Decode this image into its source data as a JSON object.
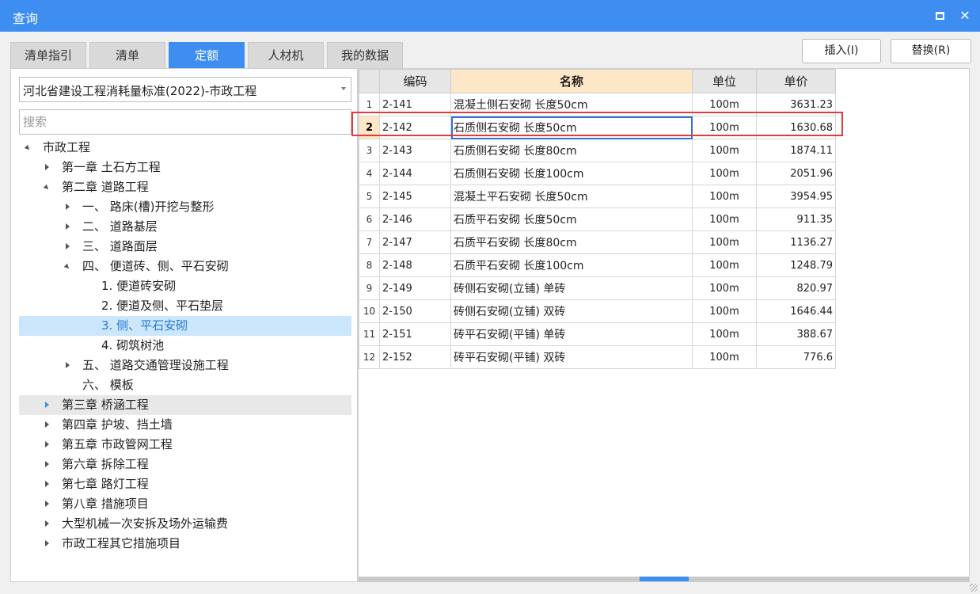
{
  "window": {
    "title": "查询"
  },
  "tabs": [
    {
      "label": "清单指引"
    },
    {
      "label": "清单"
    },
    {
      "label": "定额",
      "active": true
    },
    {
      "label": "人材机"
    },
    {
      "label": "我的数据"
    }
  ],
  "actions": {
    "insert": "插入(I)",
    "replace": "替换(R)"
  },
  "left": {
    "dropdown_value": "河北省建设工程消耗量标准(2022)-市政工程",
    "search_placeholder": "搜索"
  },
  "tree": [
    {
      "label": "市政工程",
      "level": 0,
      "state": "expanded"
    },
    {
      "label": "第一章 土石方工程",
      "level": 1,
      "state": "collapsed"
    },
    {
      "label": "第二章 道路工程",
      "level": 1,
      "state": "expanded"
    },
    {
      "label": "一、 路床(槽)开挖与整形",
      "level": 2,
      "state": "collapsed"
    },
    {
      "label": "二、 道路基层",
      "level": 2,
      "state": "collapsed"
    },
    {
      "label": "三、 道路面层",
      "level": 2,
      "state": "collapsed"
    },
    {
      "label": "四、 便道砖、侧、平石安砌",
      "level": 2,
      "state": "expanded"
    },
    {
      "label": "1. 便道砖安砌",
      "level": 3,
      "state": "leaf"
    },
    {
      "label": "2. 便道及侧、平石垫层",
      "level": 3,
      "state": "leaf"
    },
    {
      "label": "3. 侧、平石安砌",
      "level": 3,
      "state": "leaf",
      "selected": true
    },
    {
      "label": "4. 砌筑树池",
      "level": 3,
      "state": "leaf"
    },
    {
      "label": "五、 道路交通管理设施工程",
      "level": 2,
      "state": "collapsed"
    },
    {
      "label": "六、 模板",
      "level": 2,
      "state": "leaf"
    },
    {
      "label": "第三章 桥涵工程",
      "level": 1,
      "state": "collapsed",
      "hover": true
    },
    {
      "label": "第四章 护坡、挡土墙",
      "level": 1,
      "state": "collapsed"
    },
    {
      "label": "第五章 市政管网工程",
      "level": 1,
      "state": "collapsed"
    },
    {
      "label": "第六章 拆除工程",
      "level": 1,
      "state": "collapsed"
    },
    {
      "label": "第七章 路灯工程",
      "level": 1,
      "state": "collapsed"
    },
    {
      "label": "第八章 措施项目",
      "level": 1,
      "state": "collapsed"
    },
    {
      "label": "大型机械一次安拆及场外运输费",
      "level": 1,
      "state": "collapsed"
    },
    {
      "label": "市政工程其它措施项目",
      "level": 1,
      "state": "collapsed"
    }
  ],
  "grid": {
    "columns": [
      "编码",
      "名称",
      "单位",
      "单价"
    ],
    "selected_row": 2,
    "rows": [
      {
        "idx": "1",
        "code": "2-141",
        "name": "混凝土侧石安砌 长度50cm",
        "unit": "100m",
        "price": "3631.23"
      },
      {
        "idx": "2",
        "code": "2-142",
        "name": "石质侧石安砌 长度50cm",
        "unit": "100m",
        "price": "1630.68"
      },
      {
        "idx": "3",
        "code": "2-143",
        "name": "石质侧石安砌 长度80cm",
        "unit": "100m",
        "price": "1874.11"
      },
      {
        "idx": "4",
        "code": "2-144",
        "name": "石质侧石安砌 长度100cm",
        "unit": "100m",
        "price": "2051.96"
      },
      {
        "idx": "5",
        "code": "2-145",
        "name": "混凝土平石安砌 长度50cm",
        "unit": "100m",
        "price": "3954.95"
      },
      {
        "idx": "6",
        "code": "2-146",
        "name": "石质平石安砌 长度50cm",
        "unit": "100m",
        "price": "911.35"
      },
      {
        "idx": "7",
        "code": "2-147",
        "name": "石质平石安砌 长度80cm",
        "unit": "100m",
        "price": "1136.27"
      },
      {
        "idx": "8",
        "code": "2-148",
        "name": "石质平石安砌 长度100cm",
        "unit": "100m",
        "price": "1248.79"
      },
      {
        "idx": "9",
        "code": "2-149",
        "name": "砖侧石安砌(立铺) 单砖",
        "unit": "100m",
        "price": "820.97"
      },
      {
        "idx": "10",
        "code": "2-150",
        "name": "砖侧石安砌(立铺) 双砖",
        "unit": "100m",
        "price": "1646.44"
      },
      {
        "idx": "11",
        "code": "2-151",
        "name": "砖平石安砌(平铺) 单砖",
        "unit": "100m",
        "price": "388.67"
      },
      {
        "idx": "12",
        "code": "2-152",
        "name": "砖平石安砌(平铺) 双砖",
        "unit": "100m",
        "price": "776.6"
      }
    ]
  },
  "colors": {
    "accent": "#3d8ef0",
    "highlight_border": "#e43a3a",
    "selected_tree_bg": "#cce6fb",
    "header_name_bg": "#fde7c6"
  }
}
